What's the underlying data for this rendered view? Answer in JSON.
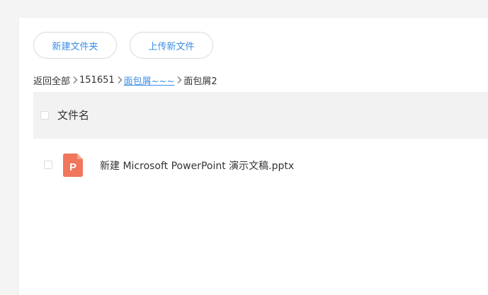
{
  "toolbar": {
    "new_folder_label": "新建文件夹",
    "upload_label": "上传新文件"
  },
  "breadcrumb": {
    "items": [
      "返回全部",
      "151651",
      "面包屑~~~",
      "面包屑2"
    ]
  },
  "table": {
    "header_label": "文件名",
    "rows": [
      {
        "name": "新建 Microsoft PowerPoint 演示文稿.pptx",
        "icon": "ppt-file-icon",
        "icon_letter": "P"
      }
    ]
  },
  "colors": {
    "accent": "#3a8ee6",
    "ppt_icon": "#f0765c",
    "header_bg": "#f2f2f2",
    "page_bg": "#f4f4f4"
  }
}
